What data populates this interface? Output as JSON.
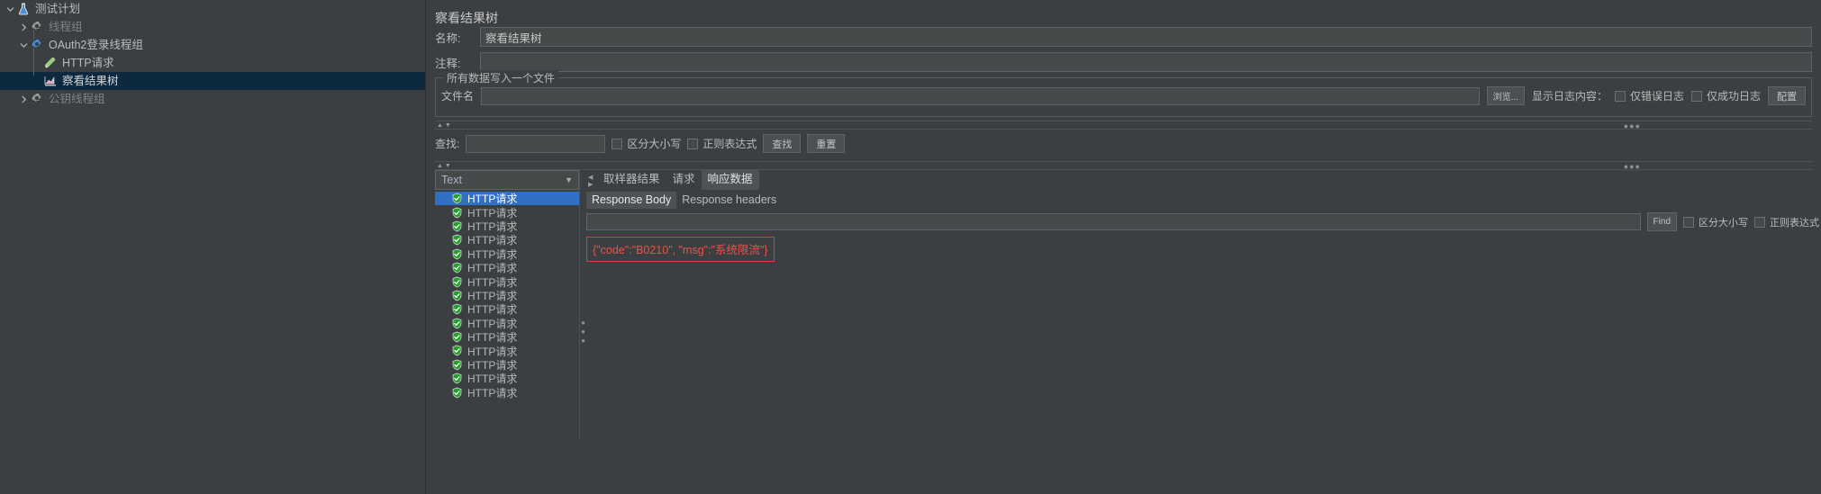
{
  "tree": {
    "items": [
      {
        "label": "测试计划",
        "icon": "test-plan-icon",
        "depth": 0,
        "arrow": "down",
        "selected": false,
        "dim": false
      },
      {
        "label": "线程组",
        "icon": "thread-group-icon",
        "depth": 1,
        "arrow": "right",
        "selected": false,
        "dim": true
      },
      {
        "label": "OAuth2登录线程组",
        "icon": "thread-group-active-icon",
        "depth": 1,
        "arrow": "down",
        "selected": false,
        "dim": false
      },
      {
        "label": "HTTP请求",
        "icon": "http-request-icon",
        "depth": 2,
        "arrow": "none",
        "selected": false,
        "dim": false
      },
      {
        "label": "察看结果树",
        "icon": "view-results-tree-icon",
        "depth": 2,
        "arrow": "none",
        "selected": true,
        "dim": false
      },
      {
        "label": "公钥线程组",
        "icon": "thread-group-icon",
        "depth": 1,
        "arrow": "right",
        "selected": false,
        "dim": true
      }
    ]
  },
  "panel": {
    "title": "察看结果树",
    "name_label": "名称:",
    "name_value": "察看结果树",
    "comment_label": "注释:",
    "comment_value": "",
    "comment_placeholder": ""
  },
  "file_group": {
    "legend": "所有数据写入一个文件",
    "filename_label": "文件名",
    "filename_value": "",
    "browse_button": "浏览...",
    "log_display_label": "显示日志内容：",
    "errors_only_label": "仅错误日志",
    "errors_only_checked": false,
    "success_only_label": "仅成功日志",
    "success_only_checked": false,
    "configure_button": "配置"
  },
  "search": {
    "label": "查找:",
    "value": "",
    "case_sensitive_label": "区分大小写",
    "case_sensitive_checked": false,
    "regex_label": "正则表达式",
    "regex_checked": false,
    "find_button": "查找",
    "reset_button": "重置"
  },
  "view": {
    "renderer_selected": "Text",
    "tabs": [
      {
        "label": "取样器结果",
        "active": false
      },
      {
        "label": "请求",
        "active": false
      },
      {
        "label": "响应数据",
        "active": true
      }
    ]
  },
  "results": {
    "rows": [
      {
        "label": "HTTP请求",
        "status": "success",
        "selected": true
      },
      {
        "label": "HTTP请求",
        "status": "success",
        "selected": false
      },
      {
        "label": "HTTP请求",
        "status": "success",
        "selected": false
      },
      {
        "label": "HTTP请求",
        "status": "success",
        "selected": false
      },
      {
        "label": "HTTP请求",
        "status": "success",
        "selected": false
      },
      {
        "label": "HTTP请求",
        "status": "success",
        "selected": false
      },
      {
        "label": "HTTP请求",
        "status": "success",
        "selected": false
      },
      {
        "label": "HTTP请求",
        "status": "success",
        "selected": false
      },
      {
        "label": "HTTP请求",
        "status": "success",
        "selected": false
      },
      {
        "label": "HTTP请求",
        "status": "success",
        "selected": false
      },
      {
        "label": "HTTP请求",
        "status": "success",
        "selected": false
      },
      {
        "label": "HTTP请求",
        "status": "success",
        "selected": false
      },
      {
        "label": "HTTP请求",
        "status": "success",
        "selected": false
      },
      {
        "label": "HTTP请求",
        "status": "success",
        "selected": false
      },
      {
        "label": "HTTP请求",
        "status": "success",
        "selected": false
      }
    ]
  },
  "response": {
    "subtabs": [
      {
        "label": "Response Body",
        "active": true
      },
      {
        "label": "Response headers",
        "active": false
      }
    ],
    "find_value": "",
    "find_button": "Find",
    "case_sensitive_label": "区分大小写",
    "case_sensitive_checked": false,
    "regex_label": "正则表达式",
    "regex_checked": false,
    "body_text": "{\"code\":\"B0210\", \"msg\":\"系统限流\"}"
  },
  "colors": {
    "background": "#3c3f41",
    "selection_blue": "#2f6fc4",
    "tree_selection": "#0d293e",
    "error_red": "#e8534a",
    "success_green": "#22a02a"
  }
}
